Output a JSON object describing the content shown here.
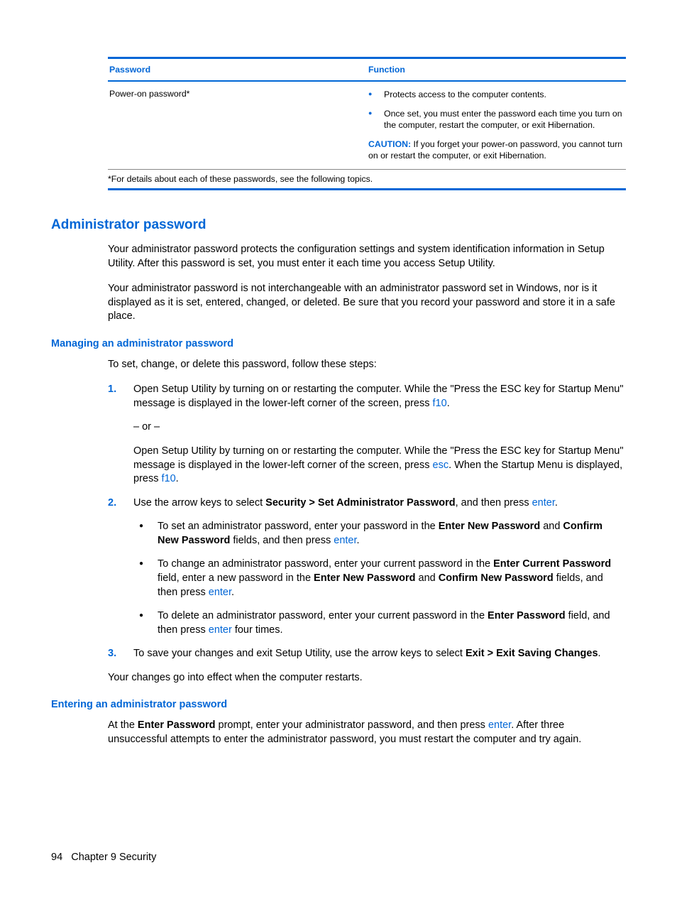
{
  "table": {
    "headers": [
      "Password",
      "Function"
    ],
    "row": {
      "password": "Power-on password*",
      "bullets": [
        "Protects access to the computer contents.",
        "Once set, you must enter the password each time you turn on the computer, restart the computer, or exit Hibernation."
      ],
      "caution_label": "CAUTION:",
      "caution_text": "If you forget your power-on password, you cannot turn on or restart the computer, or exit Hibernation."
    },
    "footnote": "*For details about each of these passwords, see the following topics."
  },
  "section": {
    "title": "Administrator password",
    "para1": "Your administrator password protects the configuration settings and system identification information in Setup Utility. After this password is set, you must enter it each time you access Setup Utility.",
    "para2": "Your administrator password is not interchangeable with an administrator password set in Windows, nor is it displayed as it is set, entered, changed, or deleted. Be sure that you record your password and store it in a safe place."
  },
  "managing": {
    "title": "Managing an administrator password",
    "intro": "To set, change, or delete this password, follow these steps:",
    "step1a_pre": "Open Setup Utility by turning on or restarting the computer. While the \"Press the ESC key for Startup Menu\" message is displayed in the lower-left corner of the screen, press ",
    "step1a_key": "f10",
    "step1a_post": ".",
    "or": "– or –",
    "step1b_pre": "Open Setup Utility by turning on or restarting the computer. While the \"Press the ESC key for Startup Menu\" message is displayed in the lower-left corner of the screen, press ",
    "step1b_key1": "esc",
    "step1b_mid": ". When the Startup Menu is displayed, press ",
    "step1b_key2": "f10",
    "step1b_post": ".",
    "step2_pre": "Use the arrow keys to select ",
    "step2_bold": "Security > Set Administrator Password",
    "step2_mid": ", and then press ",
    "step2_key": "enter",
    "step2_post": ".",
    "b1_pre": "To set an administrator password, enter your password in the ",
    "b1_bold1": "Enter New Password",
    "b1_mid1": " and ",
    "b1_bold2": "Confirm New Password",
    "b1_mid2": " fields, and then press ",
    "b1_key": "enter",
    "b1_post": ".",
    "b2_pre": "To change an administrator password, enter your current password in the ",
    "b2_bold1": "Enter Current Password",
    "b2_mid1": " field, enter a new password in the ",
    "b2_bold2": "Enter New Password",
    "b2_mid2": " and ",
    "b2_bold3": "Confirm New Password",
    "b2_mid3": " fields, and then press ",
    "b2_key": "enter",
    "b2_post": ".",
    "b3_pre": "To delete an administrator password, enter your current password in the ",
    "b3_bold": "Enter Password",
    "b3_mid": " field, and then press ",
    "b3_key": "enter",
    "b3_post": " four times.",
    "step3_pre": "To save your changes and exit Setup Utility, use the arrow keys to select ",
    "step3_bold": "Exit > Exit Saving Changes",
    "step3_post": ".",
    "outro": "Your changes go into effect when the computer restarts."
  },
  "entering": {
    "title": "Entering an administrator password",
    "pre": "At the ",
    "bold": "Enter Password",
    "mid": " prompt, enter your administrator password, and then press ",
    "key": "enter",
    "post": ". After three unsuccessful attempts to enter the administrator password, you must restart the computer and try again."
  },
  "footer": {
    "page_num": "94",
    "chapter": "Chapter 9   Security"
  }
}
